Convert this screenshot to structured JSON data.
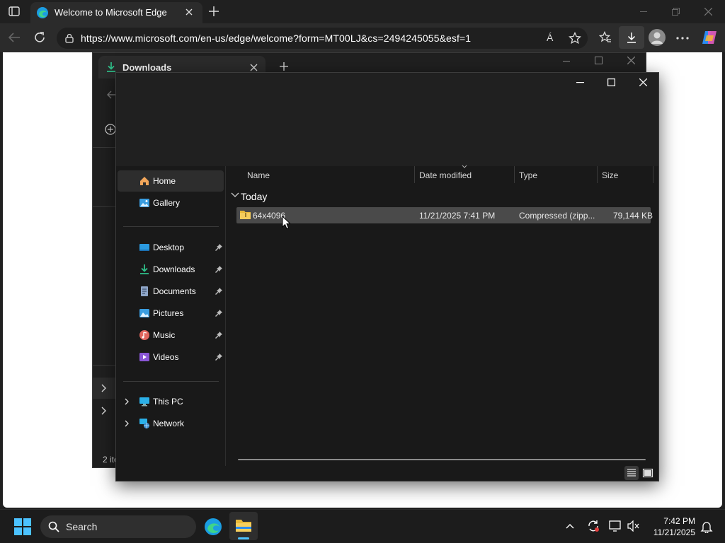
{
  "browser": {
    "tab_title": "Welcome to Microsoft Edge",
    "url": "https://www.microsoft.com/en-us/edge/welcome?form=MT00LJ&cs=2494245055&esf=1",
    "read_aloud_label": "Á"
  },
  "background_explorer": {
    "tab_title": "Downloads",
    "status": "2 ite"
  },
  "explorer": {
    "nav": {
      "home": "Home",
      "gallery": "Gallery",
      "desktop": "Desktop",
      "downloads": "Downloads",
      "documents": "Documents",
      "pictures": "Pictures",
      "music": "Music",
      "videos": "Videos",
      "this_pc": "This PC",
      "network": "Network"
    },
    "columns": {
      "name": "Name",
      "date": "Date modified",
      "type": "Type",
      "size": "Size"
    },
    "group": "Today",
    "file": {
      "name": "64x4096",
      "date": "11/21/2025 7:41 PM",
      "type": "Compressed (zipp...",
      "size": "79,144 KB"
    }
  },
  "taskbar": {
    "search": "Search",
    "time": "7:42 PM",
    "date": "11/21/2025"
  },
  "colors": {
    "accent_blue": "#0a84d6",
    "folder_yellow": "#e8b93a",
    "selection": "#4a4a4a"
  }
}
